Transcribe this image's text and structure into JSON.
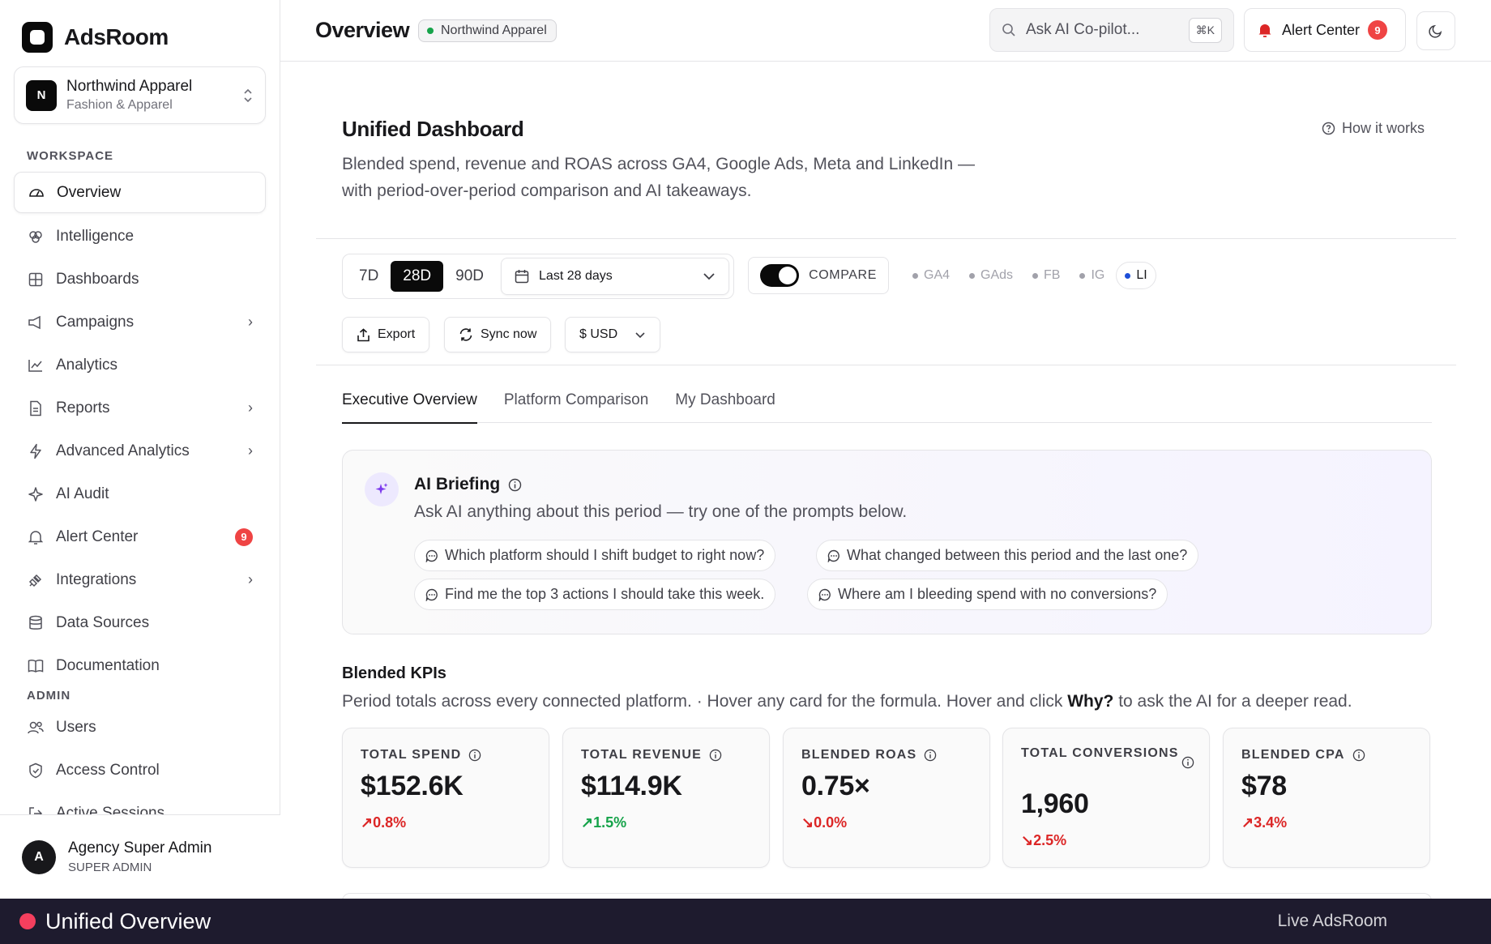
{
  "brand": {
    "name": "AdsRoom"
  },
  "account": {
    "initial": "N",
    "name": "Northwind Apparel",
    "category": "Fashion & Apparel"
  },
  "sidebar": {
    "workspace_label": "WORKSPACE",
    "admin_label": "ADMIN",
    "items": [
      {
        "label": "Overview",
        "icon": "gauge-icon"
      },
      {
        "label": "Intelligence",
        "icon": "brain-icon"
      },
      {
        "label": "Dashboards",
        "icon": "grid-icon"
      },
      {
        "label": "Campaigns",
        "icon": "megaphone-icon"
      },
      {
        "label": "Analytics",
        "icon": "line-chart-icon"
      },
      {
        "label": "Reports",
        "icon": "file-icon"
      },
      {
        "label": "Advanced Analytics",
        "icon": "bolt-icon"
      },
      {
        "label": "AI Audit",
        "icon": "sparkles-icon"
      },
      {
        "label": "Alert Center",
        "icon": "bell-icon",
        "badge": "9"
      },
      {
        "label": "Integrations",
        "icon": "plug-icon"
      },
      {
        "label": "Data Sources",
        "icon": "database-icon"
      },
      {
        "label": "Documentation",
        "icon": "book-icon"
      }
    ],
    "admin_items": [
      {
        "label": "Users",
        "icon": "users-icon"
      },
      {
        "label": "Access Control",
        "icon": "shield-icon"
      },
      {
        "label": "Active Sessions",
        "icon": "sign-in-icon"
      }
    ]
  },
  "user": {
    "initial": "A",
    "name": "Agency Super Admin",
    "role": "SUPER ADMIN"
  },
  "header": {
    "title": "Overview",
    "client_chip": "Northwind Apparel",
    "search_placeholder": "Ask AI Co-pilot...",
    "search_shortcut": "⌘K",
    "alert_label": "Alert Center",
    "alert_count": "9"
  },
  "dashboard": {
    "title": "Unified Dashboard",
    "description": "Blended spend, revenue and ROAS across GA4, Google Ads, Meta and LinkedIn — with period-over-period comparison and AI takeaways.",
    "how_it_works": "How it works"
  },
  "filters": {
    "ranges": [
      "7D",
      "28D",
      "90D"
    ],
    "selected_range": "28D",
    "date_select": "Last 28 days",
    "compare_label": "COMPARE",
    "compare_on": true,
    "platforms": [
      {
        "label": "GA4",
        "active": false
      },
      {
        "label": "GAds",
        "active": false
      },
      {
        "label": "FB",
        "active": false
      },
      {
        "label": "IG",
        "active": false
      },
      {
        "label": "LI",
        "active": true
      }
    ],
    "export_label": "Export",
    "sync_label": "Sync now",
    "currency_label": "$ USD"
  },
  "tabs": [
    {
      "label": "Executive Overview",
      "active": true
    },
    {
      "label": "Platform Comparison",
      "active": false
    },
    {
      "label": "My Dashboard",
      "active": false
    }
  ],
  "briefing": {
    "title": "AI Briefing",
    "subtitle": "Ask AI anything about this period — try one of the prompts below.",
    "prompts": [
      "Which platform should I shift budget to right now?",
      "What changed between this period and the last one?",
      "Find me the top 3 actions I should take this week.",
      "Where am I bleeding spend with no conversions?"
    ]
  },
  "kpis": {
    "title": "Blended KPIs",
    "subtitle_start": "Period totals across every connected platform. · Hover any card for the formula. Hover and click ",
    "subtitle_bold": "Why?",
    "subtitle_end": " to ask the AI for a deeper read.",
    "cards": [
      {
        "label": "TOTAL SPEND",
        "value": "$152.6K",
        "delta": "↗0.8%",
        "trend": "up"
      },
      {
        "label": "TOTAL REVENUE",
        "value": "$114.9K",
        "delta": "↗1.5%",
        "trend": "good"
      },
      {
        "label": "BLENDED ROAS",
        "value": "0.75×",
        "delta": "↘0.0%",
        "trend": "down"
      },
      {
        "label": "TOTAL CONVERSIONS",
        "value": "1,960",
        "delta": "↘2.5%",
        "trend": "down"
      },
      {
        "label": "BLENDED CPA",
        "value": "$78",
        "delta": "↗3.4%",
        "trend": "up"
      }
    ]
  },
  "bottom_bar": {
    "title": "Unified Overview",
    "right_text": "Live AdsRoom"
  },
  "colors": {
    "accent": "#0a0a0a",
    "alert": "#ef4444",
    "positive": "#16a34a",
    "negative": "#dc2626",
    "ai": "#7c3aed"
  }
}
